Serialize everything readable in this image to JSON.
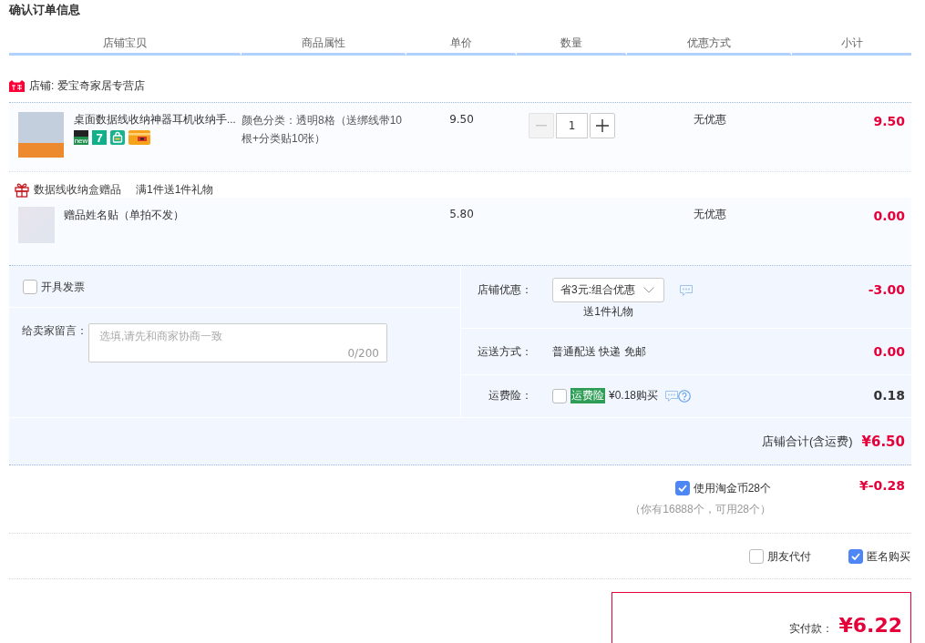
{
  "title": "确认订单信息",
  "columns": [
    "店铺宝贝",
    "商品属性",
    "单价",
    "数量",
    "优惠方式",
    "小计"
  ],
  "shop": {
    "name": "店铺: 爱宝奇家居专营店"
  },
  "products": [
    {
      "title": "桌面数据线收纳神器耳机收纳手...",
      "badges": [
        {
          "kind": "new",
          "label": "new"
        },
        {
          "kind": "seven",
          "label": "7"
        },
        {
          "kind": "bag"
        },
        {
          "kind": "card"
        }
      ],
      "attributes": "颜色分类：透明8格（送绑线带10根+分类贴10张）",
      "price": "9.50",
      "quantity": "1",
      "minus_disabled": true,
      "discount": "无优惠",
      "subtotal": "9.50"
    }
  ],
  "gift": {
    "title": "数据线收纳盒赠品",
    "rule": "满1件送1件礼物",
    "items": [
      {
        "name": "赠品姓名贴（单拍不发）",
        "price": "5.80",
        "discount": "无优惠",
        "subtotal": "0.00"
      }
    ]
  },
  "invoice": {
    "label": "开具发票",
    "checked": false
  },
  "message": {
    "label": "给卖家留言：",
    "placeholder": "选填,请先和商家协商一致",
    "counter": "0/200"
  },
  "shop_discount": {
    "label": "店铺优惠：",
    "option": "省3元:组合优惠",
    "note": "送1件礼物",
    "amount": "-3.00"
  },
  "shipping": {
    "label": "运送方式：",
    "method": "普通配送 快递 免邮",
    "amount": "0.00"
  },
  "insurance": {
    "label": "运费险：",
    "checked": false,
    "tag": "运费险",
    "price": "¥0.18购买",
    "amount": "0.18"
  },
  "shop_total": {
    "label": "店铺合计(含运费)",
    "amount": "¥6.50"
  },
  "coins": {
    "label": "使用淘金币28个",
    "checked": true,
    "note": "（你有16888个，可用28个）",
    "amount": "¥-0.28"
  },
  "options": [
    {
      "label": "朋友代付",
      "checked": false
    },
    {
      "label": "匿名购买",
      "checked": true
    }
  ],
  "payment": {
    "label": "实付款：",
    "amount": "¥6.22"
  }
}
